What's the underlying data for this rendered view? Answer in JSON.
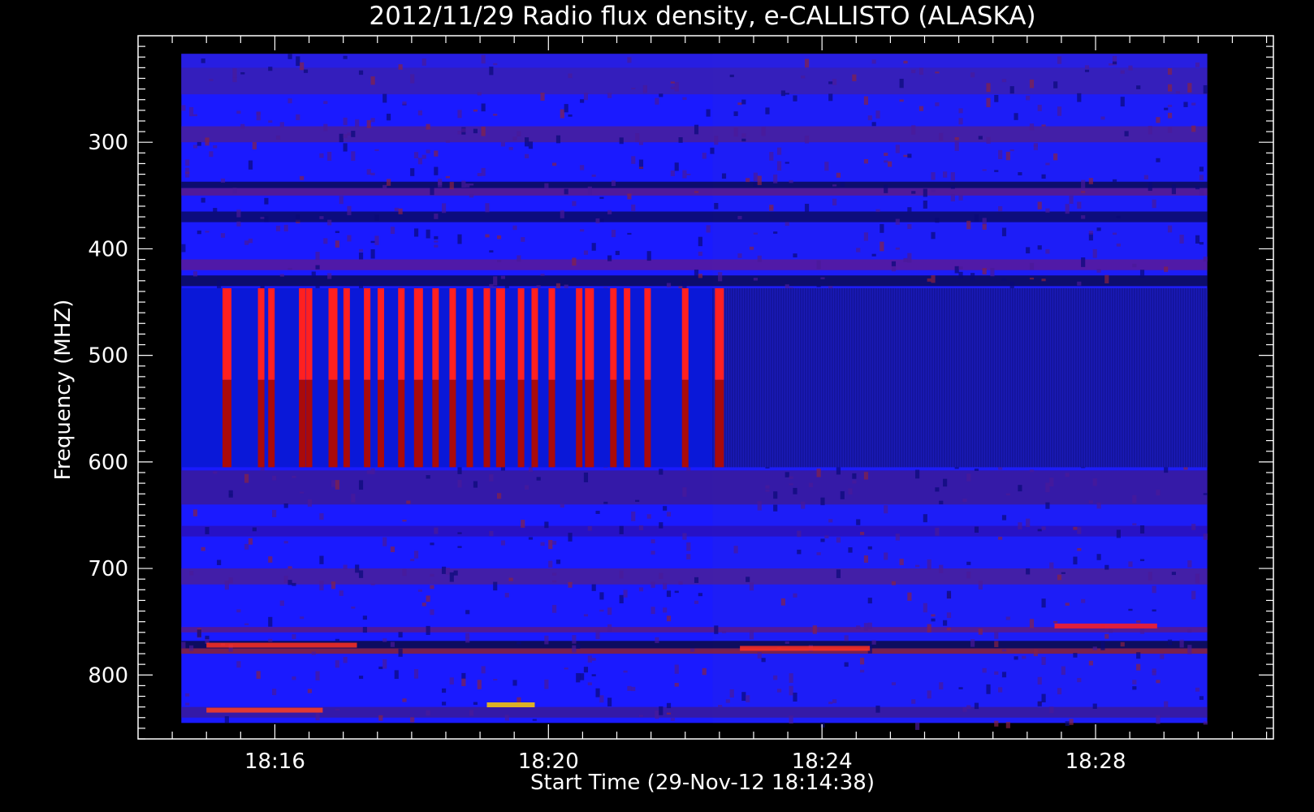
{
  "chart_data": {
    "type": "heatmap",
    "title": "2012/11/29  Radio flux density, e-CALLISTO (ALASKA)",
    "xlabel": "Start Time (29-Nov-12 18:14:38)",
    "ylabel": "Frequency (MHZ)",
    "x_range_minutes": [
      14.0,
      30.6
    ],
    "data_x_range_minutes": [
      14.633,
      29.633
    ],
    "y_range_mhz": [
      200,
      860
    ],
    "y_inverted": true,
    "x_ticks": [
      {
        "label": "18:16",
        "minute": 16
      },
      {
        "label": "18:20",
        "minute": 20
      },
      {
        "label": "18:24",
        "minute": 24
      },
      {
        "label": "18:28",
        "minute": 28
      }
    ],
    "y_ticks": [
      {
        "label": "300",
        "value": 300
      },
      {
        "label": "400",
        "value": 400
      },
      {
        "label": "500",
        "value": 500
      },
      {
        "label": "600",
        "value": 600
      },
      {
        "label": "700",
        "value": 700
      },
      {
        "label": "800",
        "value": 800
      }
    ],
    "data_y_range_mhz": [
      217,
      845
    ],
    "instrument_change_minute": 22.4,
    "colors": {
      "background": "#000000",
      "axes": "#ffffff",
      "low": "#1a1aff",
      "mid": "#3a1aaa",
      "high": "#ff2020",
      "dark_band": "#000066",
      "hot": "#ffee00"
    },
    "horizontal_bands": [
      {
        "from": 217,
        "to": 230,
        "color": "#2a20dd"
      },
      {
        "from": 230,
        "to": 255,
        "color": "#3a20b0"
      },
      {
        "from": 285,
        "to": 300,
        "color": "#4a2099"
      },
      {
        "from": 337,
        "to": 343,
        "color": "#0a0a55"
      },
      {
        "from": 343,
        "to": 350,
        "color": "#5a1a88"
      },
      {
        "from": 365,
        "to": 375,
        "color": "#0a0a66"
      },
      {
        "from": 410,
        "to": 420,
        "color": "#5a1a99"
      },
      {
        "from": 425,
        "to": 435,
        "color": "#0a0a55"
      },
      {
        "from": 608,
        "to": 640,
        "color": "#3a1a99"
      },
      {
        "from": 660,
        "to": 670,
        "color": "#2a10bb"
      },
      {
        "from": 700,
        "to": 715,
        "color": "#4a2099"
      },
      {
        "from": 755,
        "to": 760,
        "color": "#5a1a88"
      },
      {
        "from": 768,
        "to": 775,
        "color": "#0a0a44"
      },
      {
        "from": 775,
        "to": 780,
        "color": "#882233"
      },
      {
        "from": 830,
        "to": 840,
        "color": "#3a1a99"
      }
    ],
    "vertical_bursts_minutes": [
      15.3,
      15.8,
      15.95,
      16.4,
      16.5,
      16.85,
      17.05,
      17.35,
      17.55,
      17.85,
      18.1,
      18.35,
      18.6,
      18.85,
      19.1,
      19.3,
      19.6,
      19.8,
      20.05,
      20.45,
      20.6,
      20.95,
      21.15,
      21.45,
      22.0,
      22.5
    ],
    "vertical_bursts_mhz": [
      437,
      605
    ],
    "hot_spots": [
      {
        "x": 15.0,
        "x2": 16.7,
        "y": 833,
        "color": "#ff4020"
      },
      {
        "x": 19.1,
        "x2": 19.8,
        "y": 828,
        "color": "#ffcc00"
      },
      {
        "x": 27.4,
        "x2": 28.9,
        "y": 754,
        "color": "#ff2020"
      },
      {
        "x": 22.8,
        "x2": 24.7,
        "y": 775,
        "color": "#ff3020"
      },
      {
        "x": 15.0,
        "x2": 17.2,
        "y": 772,
        "color": "#ff3020"
      }
    ]
  }
}
